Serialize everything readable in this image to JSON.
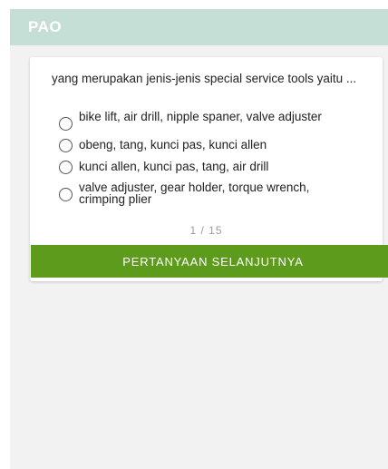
{
  "app": {
    "title": "PAO",
    "colors": {
      "appbar": "#c5dfd6",
      "button": "#5d9b1c",
      "background": "#f2f2f2"
    }
  },
  "quiz": {
    "question": "yang merupakan jenis-jenis special service tools yaitu ...",
    "options": [
      {
        "label": "bike lift, air drill, nipple spaner, valve adjuster",
        "selected": false
      },
      {
        "label": "obeng, tang, kunci pas, kunci allen",
        "selected": false
      },
      {
        "label": "kunci allen, kunci pas, tang, air drill",
        "selected": false
      },
      {
        "label": "valve adjuster, gear holder, torque wrench, crimping plier",
        "selected": false
      }
    ],
    "progress": "1 / 15",
    "next_label": "PERTANYAAN SELANJUTNYA"
  }
}
